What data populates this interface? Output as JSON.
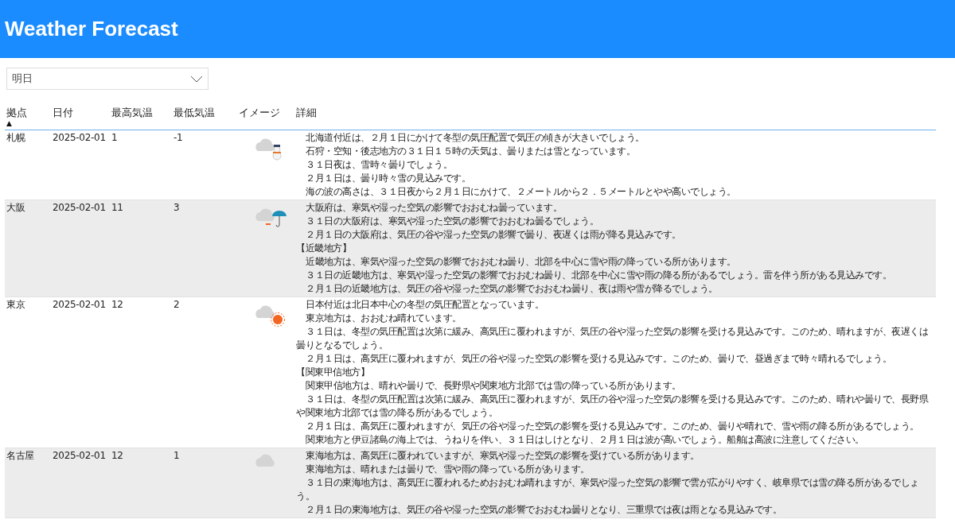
{
  "app_bar": {
    "title": "Weather Forecast"
  },
  "day_select": {
    "value": "明日"
  },
  "table": {
    "columns": [
      {
        "label": "拠点",
        "sort_arrow": "▲"
      },
      {
        "label": "日付"
      },
      {
        "label": "最高気温"
      },
      {
        "label": "最低気温"
      },
      {
        "label": "イメージ"
      },
      {
        "label": "詳細"
      }
    ],
    "rows": [
      {
        "place": "札幌",
        "date": "2025-02-01",
        "high": "1",
        "low": "-1",
        "kind": "snow",
        "details": [
          {
            "kind": "text",
            "text": "北海道付近は、２月１日にかけて冬型の気圧配置で気圧の傾きが大きいでしょう。"
          },
          {
            "kind": "text",
            "text": "石狩・空知・後志地方の３１日１５時の天気は、曇りまたは雪となっています。"
          },
          {
            "kind": "text",
            "text": "３１日夜は、雪時々曇りでしょう。"
          },
          {
            "kind": "text",
            "text": "２月１日は、曇り時々雪の見込みです。"
          },
          {
            "kind": "text",
            "text": "海の波の高さは、３１日夜から２月１日にかけて、２メートルから２．５メートルとやや高いでしょう。"
          }
        ]
      },
      {
        "place": "大阪",
        "date": "2025-02-01",
        "high": "11",
        "low": "3",
        "kind": "rain",
        "details": [
          {
            "kind": "text",
            "text": "大阪府は、寒気や湿った空気の影響でおおむね曇っています。"
          },
          {
            "kind": "text",
            "text": "３１日の大阪府は、寒気や湿った空気の影響でおおむね曇るでしょう。"
          },
          {
            "kind": "text",
            "text": "２月１日の大阪府は、気圧の谷や湿った空気の影響で曇り、夜遅くは雨が降る見込みです。"
          },
          {
            "kind": "heading",
            "text": "【近畿地方】"
          },
          {
            "kind": "text",
            "text": "近畿地方は、寒気や湿った空気の影響でおおむね曇り、北部を中心に雪や雨の降っている所があります。"
          },
          {
            "kind": "text",
            "text": "３１日の近畿地方は、寒気や湿った空気の影響でおおむね曇り、北部を中心に雪や雨の降る所があるでしょう。雷を伴う所がある見込みです。"
          },
          {
            "kind": "text",
            "text": "２月１日の近畿地方は、気圧の谷や湿った空気の影響でおおむね曇り、夜は雨や雪が降るでしょう。"
          }
        ]
      },
      {
        "place": "東京",
        "date": "2025-02-01",
        "high": "12",
        "low": "2",
        "kind": "sun",
        "details": [
          {
            "kind": "text",
            "text": "日本付近は北日本中心の冬型の気圧配置となっています。"
          },
          {
            "kind": "text",
            "text": "東京地方は、おおむね晴れています。"
          },
          {
            "kind": "text",
            "text": "３１日は、冬型の気圧配置は次第に緩み、高気圧に覆われますが、気圧の谷や湿った空気の影響を受ける見込みです。このため、晴れますが、夜遅くは曇りとなるでしょう。"
          },
          {
            "kind": "text",
            "text": "２月１日は、高気圧に覆われますが、気圧の谷や湿った空気の影響を受ける見込みです。このため、曇りで、昼過ぎまで時々晴れるでしょう。"
          },
          {
            "kind": "heading",
            "text": "【関東甲信地方】"
          },
          {
            "kind": "text",
            "text": "関東甲信地方は、晴れや曇りで、長野県や関東地方北部では雪の降っている所があります。"
          },
          {
            "kind": "text",
            "text": "３１日は、冬型の気圧配置は次第に緩み、高気圧に覆われますが、気圧の谷や湿った空気の影響を受ける見込みです。このため、晴れや曇りで、長野県や関東地方北部では雪の降る所があるでしょう。"
          },
          {
            "kind": "text",
            "text": "２月１日は、高気圧に覆われますが、気圧の谷や湿った空気の影響を受ける見込みです。このため、曇りや晴れで、雪や雨の降る所があるでしょう。"
          },
          {
            "kind": "text",
            "text": "関東地方と伊豆諸島の海上では、うねりを伴い、３１日はしけとなり、２月１日は波が高いでしょう。船舶は高波に注意してください。"
          }
        ]
      },
      {
        "place": "名古屋",
        "date": "2025-02-01",
        "high": "12",
        "low": "1",
        "kind": "cloud",
        "details": [
          {
            "kind": "text",
            "text": "東海地方は、高気圧に覆われていますが、寒気や湿った空気の影響を受けている所があります。"
          },
          {
            "kind": "text",
            "text": "東海地方は、晴れまたは曇りで、雪や雨の降っている所があります。"
          },
          {
            "kind": "text",
            "text": "３１日の東海地方は、高気圧に覆われるためおおむね晴れますが、寒気や湿った空気の影響で雲が広がりやすく、岐阜県では雪の降る所があるでしょう。"
          },
          {
            "kind": "text",
            "text": "２月１日の東海地方は、気圧の谷や湿った空気の影響でおおむね曇りとなり、三重県では夜は雨となる見込みです。"
          }
        ]
      }
    ]
  }
}
